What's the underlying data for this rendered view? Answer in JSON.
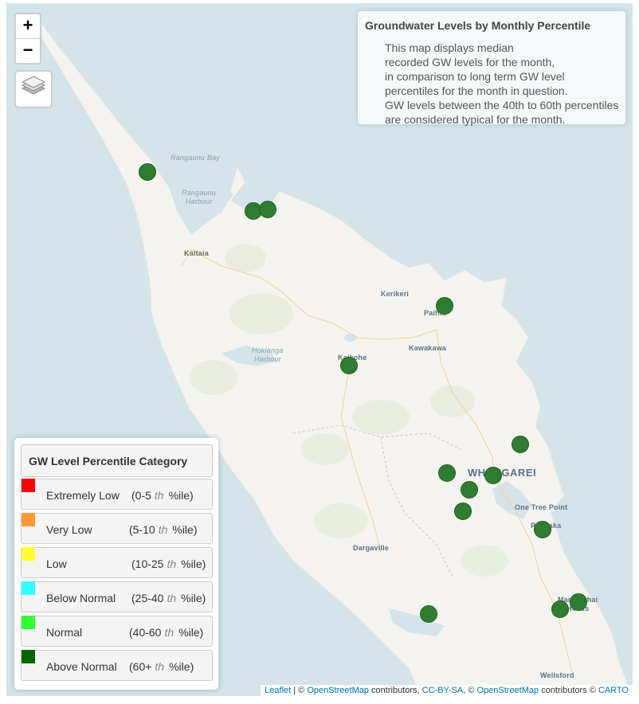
{
  "map": {
    "zoom_in": "+",
    "zoom_out": "−",
    "layers_icon": "layers-icon",
    "land_color": "#f4f3ef",
    "water_color": "#d4e4e8",
    "marker_color": "#2e7d32"
  },
  "info": {
    "title": "Groundwater Levels by Monthly Percentile",
    "lines": [
      "This map displays median",
      "recorded GW levels for the month,",
      "in comparison to long term GW level",
      "percentiles for the month in question.",
      "GW levels between the 40th to 60th percentiles",
      "are considered typical for the month."
    ]
  },
  "places": {
    "rangaunu_bay": "Rangaunu Bay",
    "rangaunu_harbour_1": "Rangaunu",
    "rangaunu_harbour_2": "Harbour",
    "kaitaia": "Kaitaia",
    "kerikeri": "Kerikeri",
    "paihia": "Paihia",
    "kawakawa": "Kawakawa",
    "hokianga_1": "Hokianga",
    "hokianga_2": "Harbour",
    "kaikohe": "Kaikohe",
    "whangarei": "WHANGAREI",
    "one_tree_point": "One Tree Point",
    "ruakaka": "Ruakaka",
    "dargaville": "Dargaville",
    "mangawhai_1": "Mangawhai",
    "mangawhai_2": "Heads",
    "wellsford": "Wellsford"
  },
  "legend": {
    "title": "GW Level Percentile Category",
    "items": [
      {
        "name": "Extremely Low",
        "range": "(0-5",
        "sup": "th",
        "unit": "%ile)",
        "color": "#ff0000"
      },
      {
        "name": "Very Low",
        "range": "(5-10",
        "sup": "th",
        "unit": "%ile)",
        "color": "#ff9933"
      },
      {
        "name": "Low",
        "range": "(10-25",
        "sup": "th",
        "unit": "%ile)",
        "color": "#ffff33"
      },
      {
        "name": "Below Normal",
        "range": "(25-40",
        "sup": "th",
        "unit": "%ile)",
        "color": "#33ffff"
      },
      {
        "name": "Normal",
        "range": "(40-60",
        "sup": "th",
        "unit": "%ile)",
        "color": "#33ff33"
      },
      {
        "name": "Above Normal",
        "range": "(60+",
        "sup": "th",
        "unit": "%ile)",
        "color": "#006600"
      }
    ]
  },
  "attribution": {
    "leaflet": "Leaflet",
    "sep1": " | © ",
    "osm1": "OpenStreetMap",
    "contrib1": " contributors, ",
    "ccbysa": "CC-BY-SA",
    "sep2": ", © ",
    "osm2": "OpenStreetMap",
    "contrib2": " contributors © ",
    "carto": "CARTO"
  }
}
